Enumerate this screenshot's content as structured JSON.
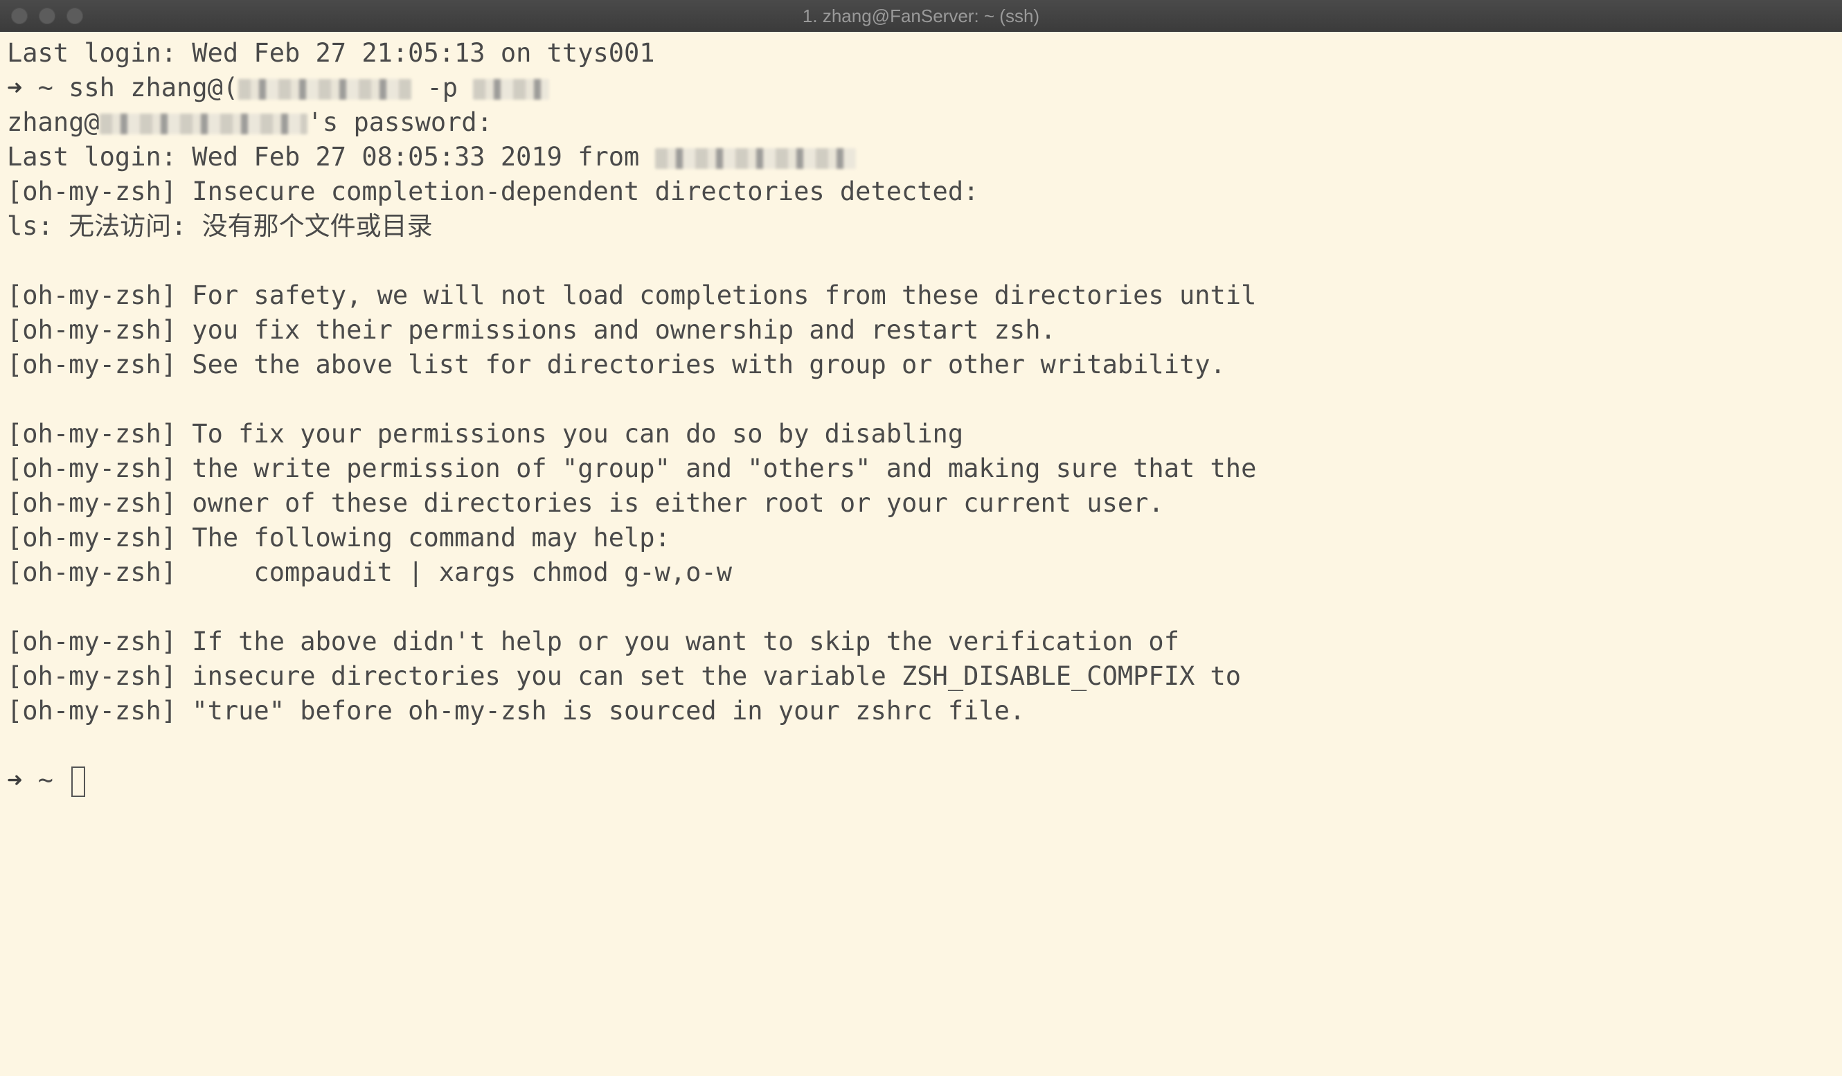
{
  "window": {
    "title": "1. zhang@FanServer: ~ (ssh)"
  },
  "terminal": {
    "last_login_local": "Last login: Wed Feb 27 21:05:13 on ttys001",
    "prompt_arrow": "➜",
    "prompt_dir": "~",
    "ssh_cmd_prefix": "ssh zhang@(",
    "ssh_port_flag": "-p",
    "password_user": "zhang@",
    "password_suffix": "'s password:",
    "last_login_remote": "Last login: Wed Feb 27 08:05:33 2019 from",
    "lines": [
      "[oh-my-zsh] Insecure completion-dependent directories detected:",
      "ls: 无法访问: 没有那个文件或目录",
      "",
      "[oh-my-zsh] For safety, we will not load completions from these directories until",
      "[oh-my-zsh] you fix their permissions and ownership and restart zsh.",
      "[oh-my-zsh] See the above list for directories with group or other writability.",
      "",
      "[oh-my-zsh] To fix your permissions you can do so by disabling",
      "[oh-my-zsh] the write permission of \"group\" and \"others\" and making sure that the",
      "[oh-my-zsh] owner of these directories is either root or your current user.",
      "[oh-my-zsh] The following command may help:",
      "[oh-my-zsh]     compaudit | xargs chmod g-w,o-w",
      "",
      "[oh-my-zsh] If the above didn't help or you want to skip the verification of",
      "[oh-my-zsh] insecure directories you can set the variable ZSH_DISABLE_COMPFIX to",
      "[oh-my-zsh] \"true\" before oh-my-zsh is sourced in your zshrc file.",
      ""
    ]
  }
}
